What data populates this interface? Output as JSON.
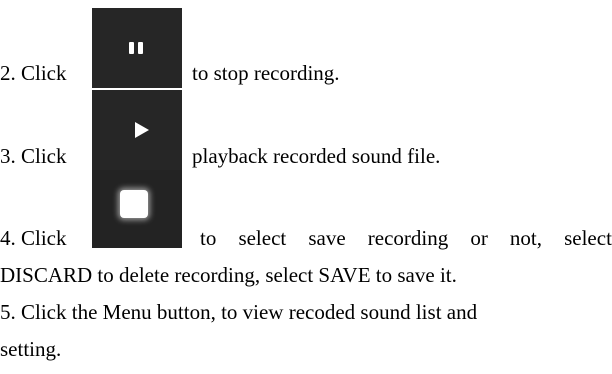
{
  "steps": {
    "step2": {
      "prefix": "2. Click",
      "suffix": "to stop recording.",
      "icon": "pause-icon"
    },
    "step3": {
      "prefix": "3. Click",
      "suffix": "playback recorded sound file.",
      "icon": "play-icon"
    },
    "step4": {
      "prefix": "4. Click",
      "suffix_words": [
        "to",
        "select",
        "save",
        "recording",
        "or",
        "not,",
        "select"
      ],
      "line2": "DISCARD to delete recording, select SAVE to save it.",
      "icon": "stop-icon"
    },
    "step5": {
      "line1": "5. Click the Menu button, to view recoded sound list and",
      "line2": "setting."
    }
  },
  "colors": {
    "icon_background": "#262626",
    "icon_glyph": "#ffffff",
    "text": "#000000"
  }
}
